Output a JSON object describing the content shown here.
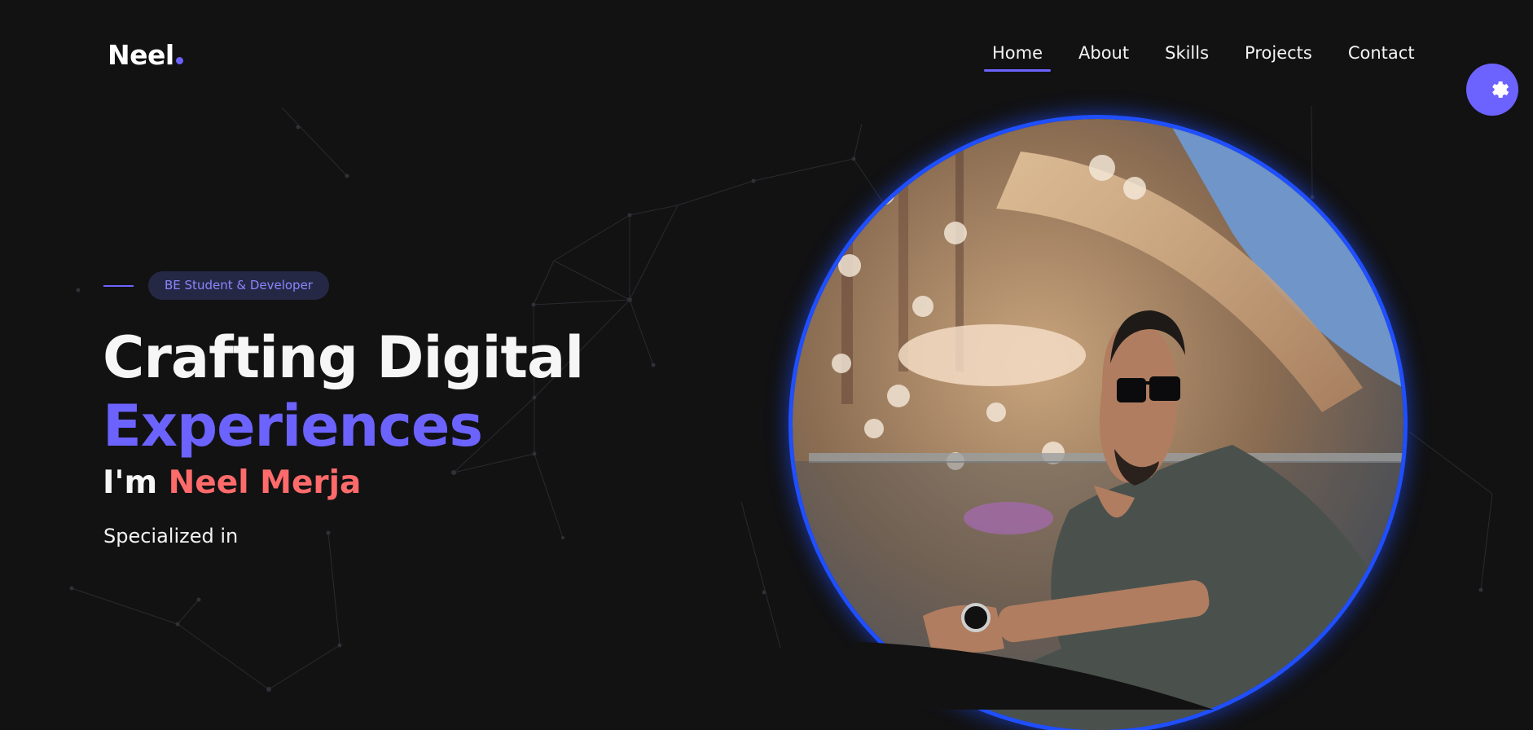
{
  "brand": {
    "name": "Neel",
    "accent": "#6c63ff"
  },
  "nav": {
    "items": [
      {
        "label": "Home",
        "active": true
      },
      {
        "label": "About",
        "active": false
      },
      {
        "label": "Skills",
        "active": false
      },
      {
        "label": "Projects",
        "active": false
      },
      {
        "label": "Contact",
        "active": false
      }
    ]
  },
  "settings": {
    "icon": "gear-icon"
  },
  "hero": {
    "tag": "BE Student & Developer",
    "title_line1": "Crafting Digital",
    "title_line2": "Experiences",
    "intro_prefix": "I'm ",
    "intro_name": "Neel Merja",
    "specialized": "Specialized in"
  },
  "colors": {
    "background": "#121213",
    "accent": "#6c63ff",
    "name_highlight": "#ff6b6b",
    "portrait_ring": "#1f4fff"
  }
}
